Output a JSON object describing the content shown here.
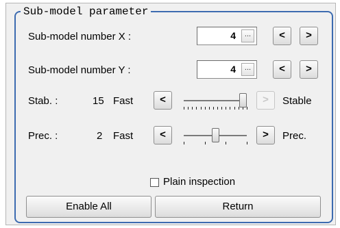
{
  "group_title": "Sub-model parameter",
  "sub_model_x": {
    "label": "Sub-model number X :",
    "value": "4",
    "ellipsis": "...",
    "prev": "<",
    "next": ">"
  },
  "sub_model_y": {
    "label": "Sub-model number Y :",
    "value": "4",
    "ellipsis": "...",
    "prev": "<",
    "next": ">"
  },
  "stab": {
    "label": "Stab. :",
    "value": "15",
    "left_label": "Fast",
    "right_label": "Stable",
    "prev": "<",
    "next": ">",
    "slider_level": 1.0,
    "next_disabled": true
  },
  "prec": {
    "label": "Prec. :",
    "value": "2",
    "left_label": "Fast",
    "right_label": "Prec.",
    "prev": "<",
    "next": ">",
    "slider_level": 0.5
  },
  "plain_inspection": {
    "label": "Plain inspection",
    "checked": false
  },
  "buttons": {
    "enable_all": "Enable All",
    "return": "Return"
  }
}
